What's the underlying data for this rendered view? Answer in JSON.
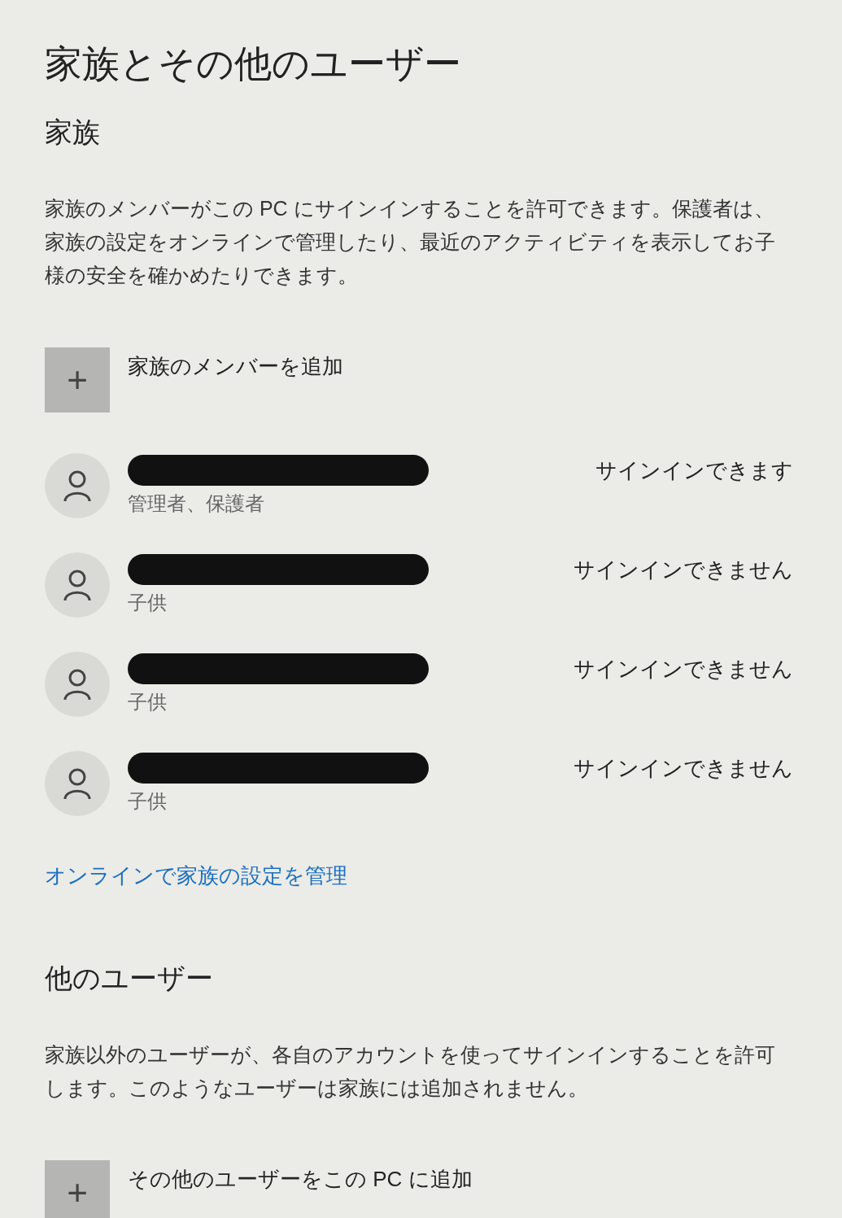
{
  "title": "家族とその他のユーザー",
  "family": {
    "heading": "家族",
    "description": "家族のメンバーがこの PC にサインインすることを許可できます。保護者は、家族の設定をオンラインで管理したり、最近のアクティビティを表示してお子様の安全を確かめたりできます。",
    "add_button": {
      "icon": "+",
      "label": "家族のメンバーを追加"
    },
    "members": [
      {
        "role": "管理者、保護者",
        "status": "サインインできます"
      },
      {
        "role": "子供",
        "status": "サインインできません"
      },
      {
        "role": "子供",
        "status": "サインインできません"
      },
      {
        "role": "子供",
        "status": "サインインできません"
      }
    ],
    "link": "オンラインで家族の設定を管理"
  },
  "others": {
    "heading": "他のユーザー",
    "description": "家族以外のユーザーが、各自のアカウントを使ってサインインすることを許可します。このようなユーザーは家族には追加されません。",
    "add_button": {
      "icon": "+",
      "label": "その他のユーザーをこの PC に追加"
    }
  }
}
